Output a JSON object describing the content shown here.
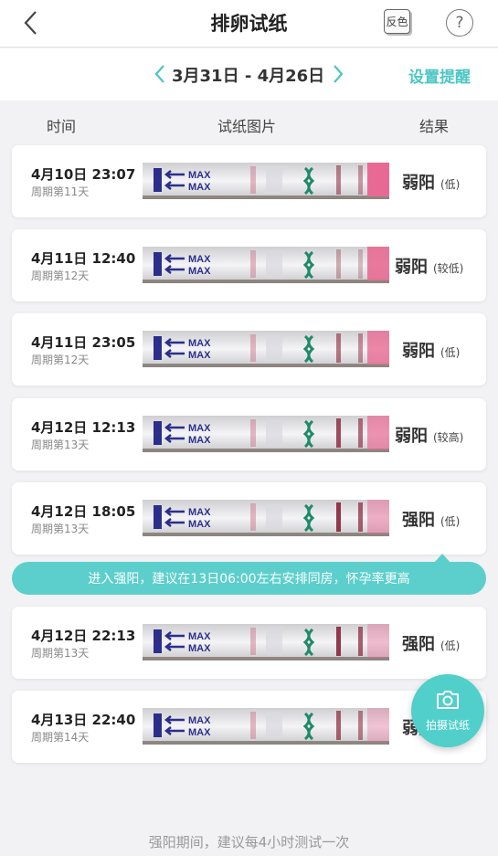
{
  "nav": {
    "title": "排卵试纸",
    "invert_label": "反色",
    "help_label": "?"
  },
  "date_range": {
    "label": "3月31日 - 4月26日",
    "remind": "设置提醒"
  },
  "columns": {
    "time": "时间",
    "image": "试纸图片",
    "result": "结果"
  },
  "records": [
    {
      "datetime": "4月10日 23:07",
      "cycle": "周期第11天",
      "result": "弱阳",
      "level": "(低)"
    },
    {
      "datetime": "4月11日 12:40",
      "cycle": "周期第12天",
      "result": "弱阳",
      "level": "(较低)"
    },
    {
      "datetime": "4月11日 23:05",
      "cycle": "周期第12天",
      "result": "弱阳",
      "level": "(低)"
    },
    {
      "datetime": "4月12日 12:13",
      "cycle": "周期第13天",
      "result": "弱阳",
      "level": "(较高)"
    },
    {
      "datetime": "4月12日 18:05",
      "cycle": "周期第13天",
      "result": "强阳",
      "level": "(低)"
    },
    {
      "datetime": "4月12日 22:13",
      "cycle": "周期第13天",
      "result": "强阳",
      "level": "(低)"
    },
    {
      "datetime": "4月13日 22:40",
      "cycle": "周期第14天",
      "result": "弱阳",
      "level": ""
    }
  ],
  "strip_text": "MAX",
  "tip": "进入强阳，建议在13日06:00左右安排同房，怀孕率更高",
  "camera_label": "拍摄试纸",
  "footer": "强阳期间，建议每4小时测试一次",
  "colors": {
    "accent": "#4cc6c4",
    "tip_bg": "#5ccfcc",
    "strip_blue": "#2b2f8a",
    "strip_pink": "#e86a94"
  }
}
